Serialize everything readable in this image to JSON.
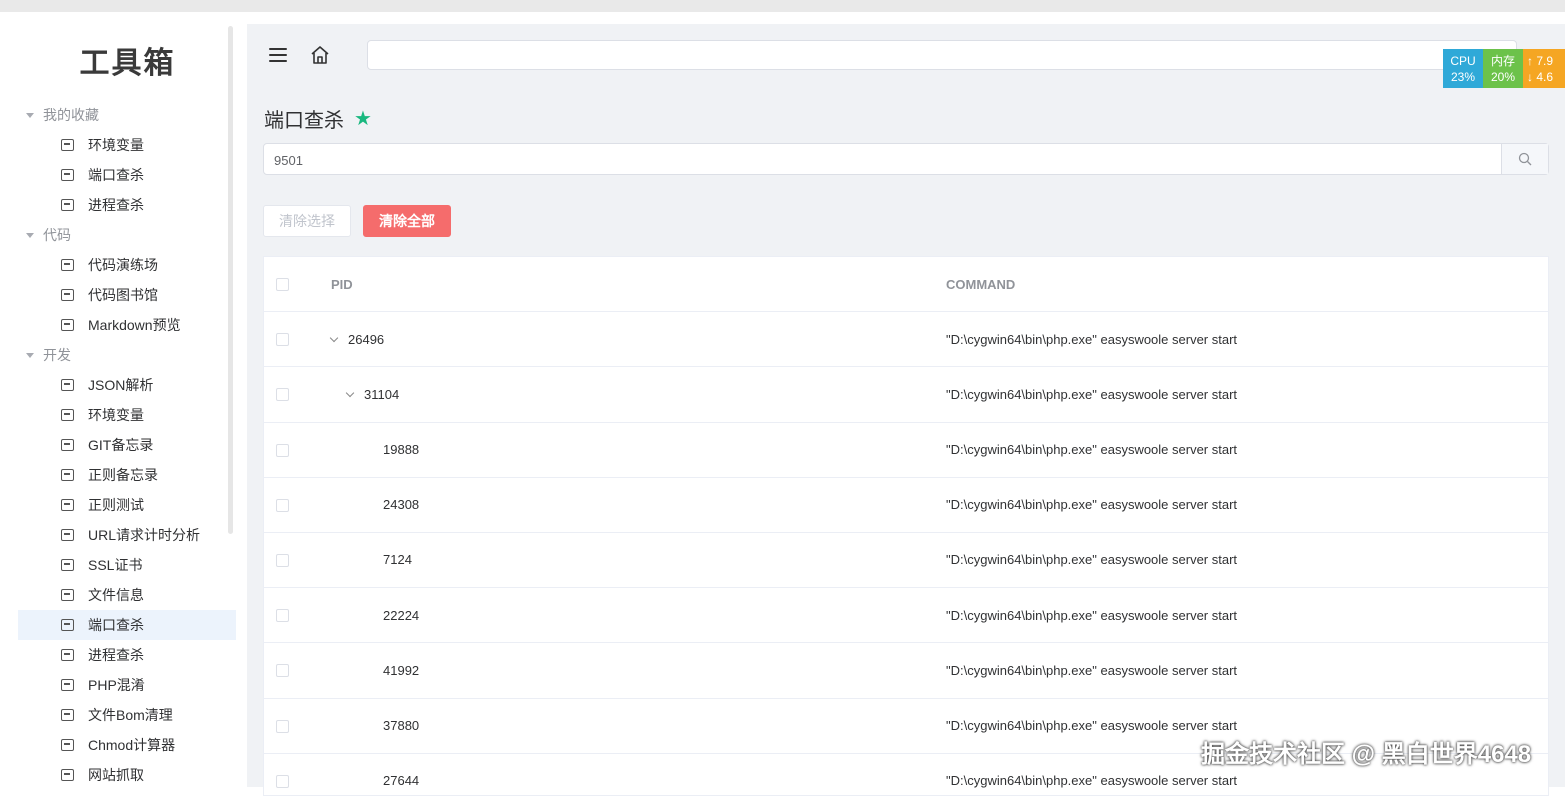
{
  "sidebar": {
    "logo": "工具箱",
    "groups": [
      {
        "label": "我的收藏",
        "items": [
          "环境变量",
          "端口查杀",
          "进程查杀"
        ]
      },
      {
        "label": "代码",
        "items": [
          "代码演练场",
          "代码图书馆",
          "Markdown预览"
        ]
      },
      {
        "label": "开发",
        "items": [
          "JSON解析",
          "环境变量",
          "GIT备忘录",
          "正则备忘录",
          "正则测试",
          "URL请求计时分析",
          "SSL证书",
          "文件信息",
          "端口查杀",
          "进程查杀",
          "PHP混淆",
          "文件Bom清理",
          "Chmod计算器",
          "网站抓取"
        ]
      }
    ],
    "active_item": "端口查杀"
  },
  "monitor": {
    "cpu_label": "CPU",
    "cpu_value": "23%",
    "mem_label": "内存",
    "mem_value": "20%",
    "up": "7.9",
    "down": "4.6"
  },
  "page": {
    "title": "端口查杀",
    "search_value": "9501",
    "clear_selection": "清除选择",
    "clear_all": "清除全部"
  },
  "table": {
    "columns": [
      "PID",
      "COMMAND"
    ],
    "rows": [
      {
        "pid": "26496",
        "level": 0,
        "expanded": true,
        "command": "\"D:\\cygwin64\\bin\\php.exe\" easyswoole server start"
      },
      {
        "pid": "31104",
        "level": 1,
        "expanded": true,
        "command": "\"D:\\cygwin64\\bin\\php.exe\" easyswoole server start"
      },
      {
        "pid": "19888",
        "level": 2,
        "expanded": false,
        "command": "\"D:\\cygwin64\\bin\\php.exe\" easyswoole server start"
      },
      {
        "pid": "24308",
        "level": 2,
        "expanded": false,
        "command": "\"D:\\cygwin64\\bin\\php.exe\" easyswoole server start"
      },
      {
        "pid": "7124",
        "level": 2,
        "expanded": false,
        "command": "\"D:\\cygwin64\\bin\\php.exe\" easyswoole server start"
      },
      {
        "pid": "22224",
        "level": 2,
        "expanded": false,
        "command": "\"D:\\cygwin64\\bin\\php.exe\" easyswoole server start"
      },
      {
        "pid": "41992",
        "level": 2,
        "expanded": false,
        "command": "\"D:\\cygwin64\\bin\\php.exe\" easyswoole server start"
      },
      {
        "pid": "37880",
        "level": 2,
        "expanded": false,
        "command": "\"D:\\cygwin64\\bin\\php.exe\" easyswoole server start"
      },
      {
        "pid": "27644",
        "level": 2,
        "expanded": false,
        "command": "\"D:\\cygwin64\\bin\\php.exe\" easyswoole server start"
      }
    ]
  },
  "watermark": "掘金技术社区 @ 黑白世界4648",
  "colors": {
    "accent": "#409eff",
    "danger": "#f56c6c",
    "star": "#19b87f"
  }
}
